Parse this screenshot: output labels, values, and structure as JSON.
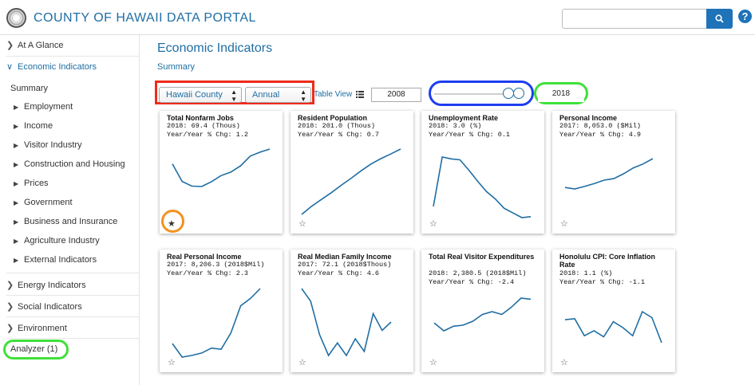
{
  "header": {
    "title": "COUNTY OF HAWAII DATA PORTAL",
    "search_placeholder": "",
    "help_label": "?"
  },
  "sidebar": {
    "sections_top": [
      {
        "label": "At A Glance",
        "chevron": ">"
      },
      {
        "label": "Economic Indicators",
        "chevron": "v"
      }
    ],
    "summary_label": "Summary",
    "sub_items": [
      "Employment",
      "Income",
      "Visitor Industry",
      "Construction and Housing",
      "Prices",
      "Government",
      "Business and Insurance",
      "Agriculture Industry",
      "External Indicators"
    ],
    "sections_bottom": [
      {
        "label": "Energy Indicators",
        "chevron": ">"
      },
      {
        "label": "Social Indicators",
        "chevron": ">"
      },
      {
        "label": "Environment",
        "chevron": ">"
      }
    ],
    "analyzer_label": "Analyzer (1)"
  },
  "main": {
    "title": "Economic Indicators",
    "subtitle": "Summary",
    "geo_select": "Hawaii County",
    "freq_select": "Annual",
    "table_view_label": "Table View",
    "start_year": "2008",
    "end_year": "2018",
    "slider": {
      "min_year": 2008,
      "max_year": 2018,
      "start_frac": 0.82,
      "end_frac": 0.94
    }
  },
  "cards": [
    {
      "title": "Total Nonfarm Jobs",
      "line1": "2018: 69.4 (Thous)",
      "line2": "Year/Year % Chg: 1.2",
      "values": [
        69.0,
        64.5,
        63.3,
        63.2,
        64.4,
        66.0,
        66.9,
        68.5,
        71.0,
        72.0,
        72.8
      ],
      "starred": true
    },
    {
      "title": "Resident Population",
      "line1": "2018: 201.0 (Thous)",
      "line2": "Year/Year % Chg: 0.7",
      "values": [
        180.0,
        183.0,
        185.5,
        188.0,
        190.7,
        193.3,
        196.0,
        198.5,
        200.5,
        202.2,
        204.0
      ],
      "starred": false
    },
    {
      "title": "Unemployment Rate",
      "line1": "2018: 3.0 (%)",
      "line2": "Year/Year % Chg: 0.1",
      "values": [
        5.0,
        10.3,
        10.1,
        10.0,
        8.9,
        7.7,
        6.6,
        5.8,
        4.8,
        4.3,
        3.8,
        3.9
      ],
      "starred": false
    },
    {
      "title": "Personal Income",
      "line1": "2017: 8,053.0 ($Mil)",
      "line2": "Year/Year % Chg: 4.9",
      "values": [
        5.8,
        5.65,
        5.9,
        6.2,
        6.55,
        6.7,
        7.2,
        7.8,
        8.2,
        8.75
      ],
      "starred": false
    },
    {
      "title": "Real Personal Income",
      "line1": "2017: 8,206.3 (2018$Mil)",
      "line2": "Year/Year % Chg: 2.3",
      "values": [
        6.95,
        6.62,
        6.66,
        6.72,
        6.84,
        6.81,
        7.21,
        7.87,
        8.05,
        8.29
      ],
      "starred": false
    },
    {
      "title": "Real Median Family Income",
      "line1": "2017: 72.1 (2018$Thous)",
      "line2": "Year/Year % Chg: 4.6",
      "values": [
        82.0,
        79.0,
        71.0,
        66.0,
        69.0,
        66.0,
        70.0,
        67.0,
        76.0,
        72.0,
        74.0
      ],
      "starred": false
    },
    {
      "title": "Total Real Visitor Expenditures",
      "line1": "2018: 2,380.5 (2018$Mil)",
      "line2": "Year/Year % Chg: -2.4",
      "values": [
        1.92,
        1.78,
        1.86,
        1.88,
        1.95,
        2.07,
        2.12,
        2.07,
        2.2,
        2.36,
        2.34
      ],
      "starred": false
    },
    {
      "title": "Honolulu CPI: Core Inflation Rate",
      "line1": "2018: 1.1 (%)",
      "line2": "Year/Year % Chg: -1.1",
      "values": [
        2.6,
        2.7,
        1.0,
        1.5,
        0.9,
        2.4,
        1.8,
        1.0,
        3.4,
        2.8,
        0.3
      ],
      "starred": false
    }
  ],
  "colors": {
    "accent": "#1f6ea3",
    "line": "#1f6ea3",
    "red_box": "#ef2a1a",
    "blue_box": "#1d3ef0",
    "green_box": "#3fe13a",
    "orange_ring": "#f39220"
  },
  "icons": {
    "search": "search-icon",
    "star": "star-icon",
    "help": "help-icon",
    "list": "list-icon",
    "seal": "county-seal-icon"
  }
}
